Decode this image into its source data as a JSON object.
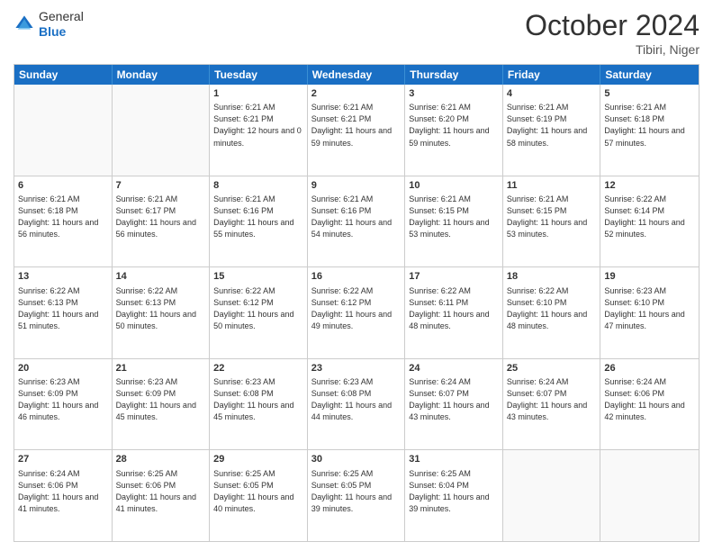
{
  "header": {
    "logo_line1": "General",
    "logo_line2": "Blue",
    "month_year": "October 2024",
    "location": "Tibiri, Niger"
  },
  "days": [
    "Sunday",
    "Monday",
    "Tuesday",
    "Wednesday",
    "Thursday",
    "Friday",
    "Saturday"
  ],
  "weeks": [
    [
      {
        "day": "",
        "empty": true
      },
      {
        "day": "",
        "empty": true
      },
      {
        "day": "1",
        "sunrise": "Sunrise: 6:21 AM",
        "sunset": "Sunset: 6:21 PM",
        "daylight": "Daylight: 12 hours and 0 minutes."
      },
      {
        "day": "2",
        "sunrise": "Sunrise: 6:21 AM",
        "sunset": "Sunset: 6:21 PM",
        "daylight": "Daylight: 11 hours and 59 minutes."
      },
      {
        "day": "3",
        "sunrise": "Sunrise: 6:21 AM",
        "sunset": "Sunset: 6:20 PM",
        "daylight": "Daylight: 11 hours and 59 minutes."
      },
      {
        "day": "4",
        "sunrise": "Sunrise: 6:21 AM",
        "sunset": "Sunset: 6:19 PM",
        "daylight": "Daylight: 11 hours and 58 minutes."
      },
      {
        "day": "5",
        "sunrise": "Sunrise: 6:21 AM",
        "sunset": "Sunset: 6:18 PM",
        "daylight": "Daylight: 11 hours and 57 minutes."
      }
    ],
    [
      {
        "day": "6",
        "sunrise": "Sunrise: 6:21 AM",
        "sunset": "Sunset: 6:18 PM",
        "daylight": "Daylight: 11 hours and 56 minutes."
      },
      {
        "day": "7",
        "sunrise": "Sunrise: 6:21 AM",
        "sunset": "Sunset: 6:17 PM",
        "daylight": "Daylight: 11 hours and 56 minutes."
      },
      {
        "day": "8",
        "sunrise": "Sunrise: 6:21 AM",
        "sunset": "Sunset: 6:16 PM",
        "daylight": "Daylight: 11 hours and 55 minutes."
      },
      {
        "day": "9",
        "sunrise": "Sunrise: 6:21 AM",
        "sunset": "Sunset: 6:16 PM",
        "daylight": "Daylight: 11 hours and 54 minutes."
      },
      {
        "day": "10",
        "sunrise": "Sunrise: 6:21 AM",
        "sunset": "Sunset: 6:15 PM",
        "daylight": "Daylight: 11 hours and 53 minutes."
      },
      {
        "day": "11",
        "sunrise": "Sunrise: 6:21 AM",
        "sunset": "Sunset: 6:15 PM",
        "daylight": "Daylight: 11 hours and 53 minutes."
      },
      {
        "day": "12",
        "sunrise": "Sunrise: 6:22 AM",
        "sunset": "Sunset: 6:14 PM",
        "daylight": "Daylight: 11 hours and 52 minutes."
      }
    ],
    [
      {
        "day": "13",
        "sunrise": "Sunrise: 6:22 AM",
        "sunset": "Sunset: 6:13 PM",
        "daylight": "Daylight: 11 hours and 51 minutes."
      },
      {
        "day": "14",
        "sunrise": "Sunrise: 6:22 AM",
        "sunset": "Sunset: 6:13 PM",
        "daylight": "Daylight: 11 hours and 50 minutes."
      },
      {
        "day": "15",
        "sunrise": "Sunrise: 6:22 AM",
        "sunset": "Sunset: 6:12 PM",
        "daylight": "Daylight: 11 hours and 50 minutes."
      },
      {
        "day": "16",
        "sunrise": "Sunrise: 6:22 AM",
        "sunset": "Sunset: 6:12 PM",
        "daylight": "Daylight: 11 hours and 49 minutes."
      },
      {
        "day": "17",
        "sunrise": "Sunrise: 6:22 AM",
        "sunset": "Sunset: 6:11 PM",
        "daylight": "Daylight: 11 hours and 48 minutes."
      },
      {
        "day": "18",
        "sunrise": "Sunrise: 6:22 AM",
        "sunset": "Sunset: 6:10 PM",
        "daylight": "Daylight: 11 hours and 48 minutes."
      },
      {
        "day": "19",
        "sunrise": "Sunrise: 6:23 AM",
        "sunset": "Sunset: 6:10 PM",
        "daylight": "Daylight: 11 hours and 47 minutes."
      }
    ],
    [
      {
        "day": "20",
        "sunrise": "Sunrise: 6:23 AM",
        "sunset": "Sunset: 6:09 PM",
        "daylight": "Daylight: 11 hours and 46 minutes."
      },
      {
        "day": "21",
        "sunrise": "Sunrise: 6:23 AM",
        "sunset": "Sunset: 6:09 PM",
        "daylight": "Daylight: 11 hours and 45 minutes."
      },
      {
        "day": "22",
        "sunrise": "Sunrise: 6:23 AM",
        "sunset": "Sunset: 6:08 PM",
        "daylight": "Daylight: 11 hours and 45 minutes."
      },
      {
        "day": "23",
        "sunrise": "Sunrise: 6:23 AM",
        "sunset": "Sunset: 6:08 PM",
        "daylight": "Daylight: 11 hours and 44 minutes."
      },
      {
        "day": "24",
        "sunrise": "Sunrise: 6:24 AM",
        "sunset": "Sunset: 6:07 PM",
        "daylight": "Daylight: 11 hours and 43 minutes."
      },
      {
        "day": "25",
        "sunrise": "Sunrise: 6:24 AM",
        "sunset": "Sunset: 6:07 PM",
        "daylight": "Daylight: 11 hours and 43 minutes."
      },
      {
        "day": "26",
        "sunrise": "Sunrise: 6:24 AM",
        "sunset": "Sunset: 6:06 PM",
        "daylight": "Daylight: 11 hours and 42 minutes."
      }
    ],
    [
      {
        "day": "27",
        "sunrise": "Sunrise: 6:24 AM",
        "sunset": "Sunset: 6:06 PM",
        "daylight": "Daylight: 11 hours and 41 minutes."
      },
      {
        "day": "28",
        "sunrise": "Sunrise: 6:25 AM",
        "sunset": "Sunset: 6:06 PM",
        "daylight": "Daylight: 11 hours and 41 minutes."
      },
      {
        "day": "29",
        "sunrise": "Sunrise: 6:25 AM",
        "sunset": "Sunset: 6:05 PM",
        "daylight": "Daylight: 11 hours and 40 minutes."
      },
      {
        "day": "30",
        "sunrise": "Sunrise: 6:25 AM",
        "sunset": "Sunset: 6:05 PM",
        "daylight": "Daylight: 11 hours and 39 minutes."
      },
      {
        "day": "31",
        "sunrise": "Sunrise: 6:25 AM",
        "sunset": "Sunset: 6:04 PM",
        "daylight": "Daylight: 11 hours and 39 minutes."
      },
      {
        "day": "",
        "empty": true
      },
      {
        "day": "",
        "empty": true
      }
    ]
  ]
}
